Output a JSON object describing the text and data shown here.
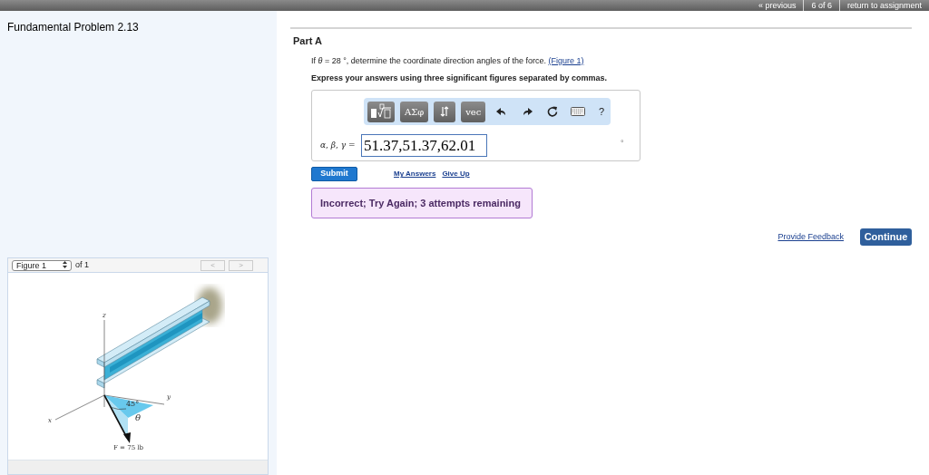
{
  "top_nav": {
    "previous": "« previous",
    "position": "6 of 6",
    "return": "return to assignment"
  },
  "problem_title": "Fundamental Problem 2.13",
  "figure_panel": {
    "select_value": "Figure 1",
    "of_text": "of 1",
    "prev": "<",
    "next": ">",
    "labels": [
      "z",
      "y",
      "x",
      "45°",
      "θ",
      "F = 75 lb"
    ]
  },
  "part": {
    "title": "Part A",
    "question": "If *θ* = 28 °, determine the coordinate direction angles of the force.",
    "figure_link": "(Figure 1)",
    "instruction": "Express your answers using three significant figures separated by commas.",
    "toolbar": [
      {
        "kind": "templates"
      },
      {
        "kind": "text",
        "label": "ΑΣφ"
      },
      {
        "kind": "arrows"
      },
      {
        "kind": "text",
        "label": "vec"
      },
      {
        "kind": "undo"
      },
      {
        "kind": "redo"
      },
      {
        "kind": "reset"
      },
      {
        "kind": "keyboard"
      },
      {
        "kind": "help",
        "label": "?"
      }
    ],
    "answer_label": "*α*, *β*, *γ* =",
    "answer_value": "51.37,51.37,62.01",
    "unit": "°",
    "submit": "Submit",
    "links": [
      "My Answers",
      "Give Up"
    ],
    "feedback": "Incorrect; Try Again; 3 attempts remaining"
  },
  "provide_feedback": "Provide Feedback",
  "continue": "Continue"
}
